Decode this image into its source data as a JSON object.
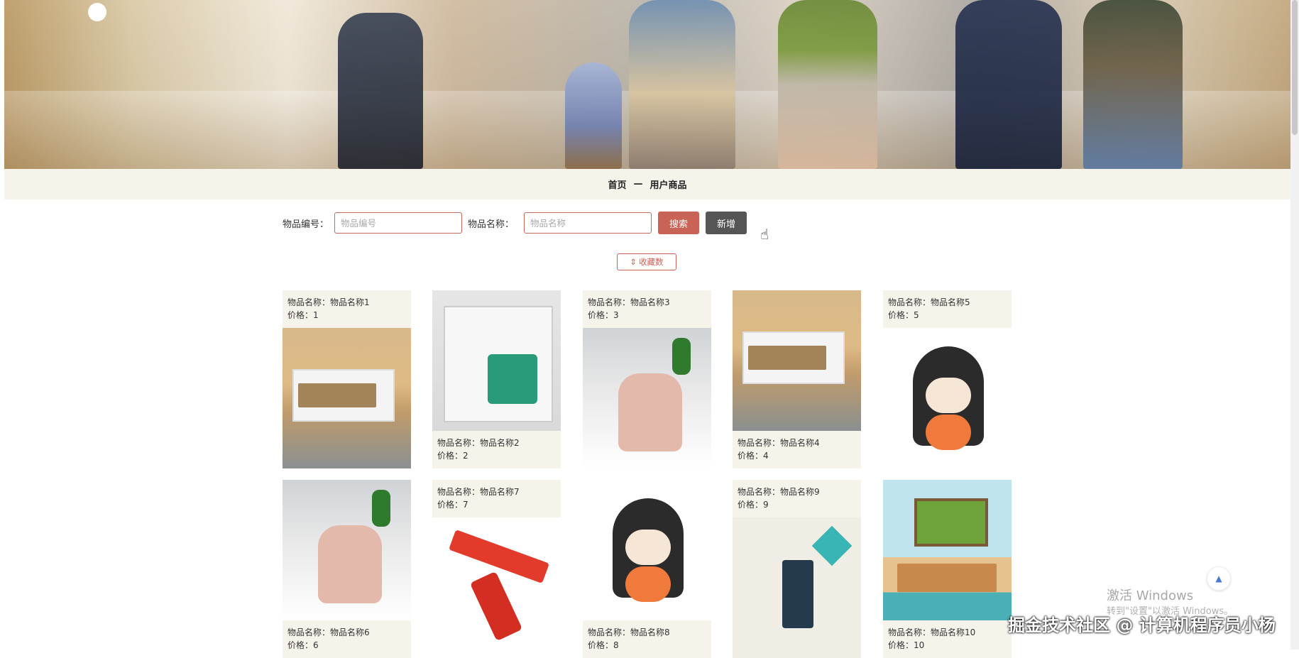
{
  "breadcrumb": {
    "home": "首页",
    "separator": "—",
    "current": "用户商品"
  },
  "search": {
    "code_label": "物品编号：",
    "code_placeholder": "物品编号",
    "name_label": "物品名称：",
    "name_placeholder": "物品名称",
    "search_button": "搜索",
    "add_button": "新增"
  },
  "sort": {
    "icon": "sort-icon",
    "label": "收藏数"
  },
  "product_meta": {
    "name_prefix": "物品名称：",
    "price_prefix": "价格："
  },
  "products": [
    {
      "name": "物品名称1",
      "price": "1"
    },
    {
      "name": "物品名称2",
      "price": "2"
    },
    {
      "name": "物品名称3",
      "price": "3"
    },
    {
      "name": "物品名称4",
      "price": "4"
    },
    {
      "name": "物品名称5",
      "price": "5"
    },
    {
      "name": "物品名称6",
      "price": "6"
    },
    {
      "name": "物品名称7",
      "price": "7"
    },
    {
      "name": "物品名称8",
      "price": "8"
    },
    {
      "name": "物品名称9",
      "price": "9"
    },
    {
      "name": "物品名称10",
      "price": "10"
    }
  ],
  "back_to_top": {
    "icon": "arrow-up-icon"
  },
  "watermark": {
    "activate_title": "激活 Windows",
    "activate_sub": "转到\"设置\"以激活 Windows。",
    "credit": "掘金技术社区 @ 计算机程序员小杨"
  },
  "colors": {
    "accent": "#c96356",
    "add_button": "#555555",
    "meta_bg": "#f5f3ea"
  }
}
